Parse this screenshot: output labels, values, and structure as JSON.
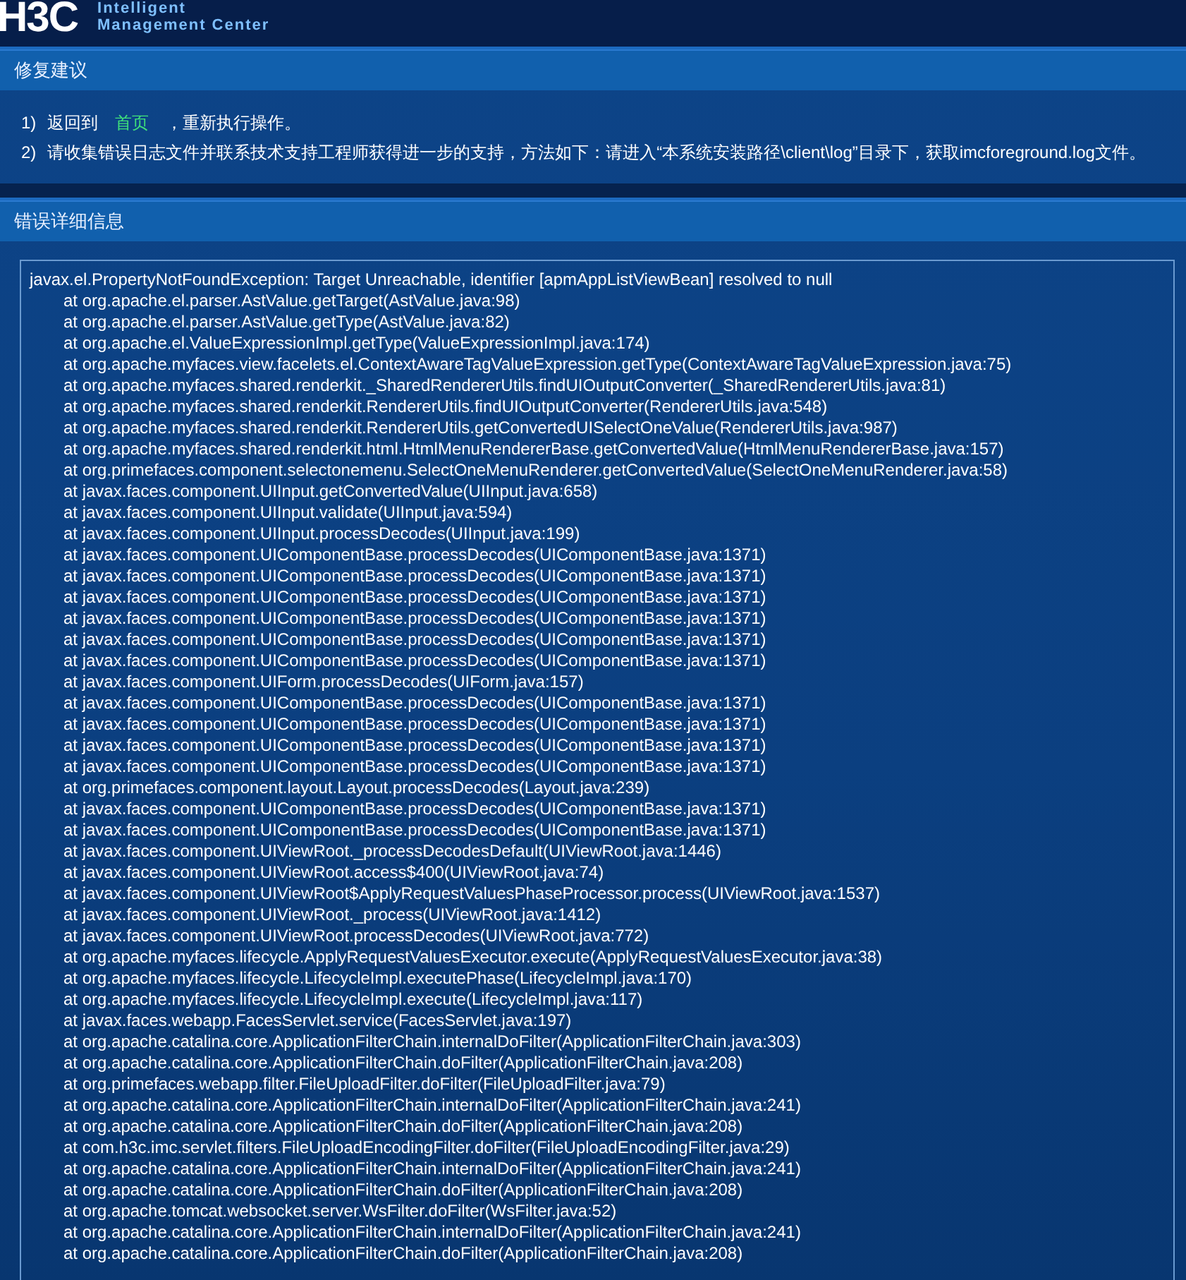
{
  "header": {
    "logo": "H3C",
    "product_line_1": "Intelligent",
    "product_line_2": "Management Center"
  },
  "repair": {
    "title": "修复建议",
    "steps": [
      {
        "number": "1)",
        "before": "返回到",
        "link": "首页",
        "after": "，重新执行操作。"
      },
      {
        "number": "2)",
        "before": "请收集错误日志文件并联系技术支持工程师获得进一步的支持，方法如下：请进入“本系统安装路径\\client\\log”目录下，获取imcforeground.log文件。"
      }
    ]
  },
  "details": {
    "title": "错误详细信息",
    "exception": "javax.el.PropertyNotFoundException: Target Unreachable, identifier [apmAppListViewBean] resolved to null",
    "frames": [
      "at org.apache.el.parser.AstValue.getTarget(AstValue.java:98)",
      "at org.apache.el.parser.AstValue.getType(AstValue.java:82)",
      "at org.apache.el.ValueExpressionImpl.getType(ValueExpressionImpl.java:174)",
      "at org.apache.myfaces.view.facelets.el.ContextAwareTagValueExpression.getType(ContextAwareTagValueExpression.java:75)",
      "at org.apache.myfaces.shared.renderkit._SharedRendererUtils.findUIOutputConverter(_SharedRendererUtils.java:81)",
      "at org.apache.myfaces.shared.renderkit.RendererUtils.findUIOutputConverter(RendererUtils.java:548)",
      "at org.apache.myfaces.shared.renderkit.RendererUtils.getConvertedUISelectOneValue(RendererUtils.java:987)",
      "at org.apache.myfaces.shared.renderkit.html.HtmlMenuRendererBase.getConvertedValue(HtmlMenuRendererBase.java:157)",
      "at org.primefaces.component.selectonemenu.SelectOneMenuRenderer.getConvertedValue(SelectOneMenuRenderer.java:58)",
      "at javax.faces.component.UIInput.getConvertedValue(UIInput.java:658)",
      "at javax.faces.component.UIInput.validate(UIInput.java:594)",
      "at javax.faces.component.UIInput.processDecodes(UIInput.java:199)",
      "at javax.faces.component.UIComponentBase.processDecodes(UIComponentBase.java:1371)",
      "at javax.faces.component.UIComponentBase.processDecodes(UIComponentBase.java:1371)",
      "at javax.faces.component.UIComponentBase.processDecodes(UIComponentBase.java:1371)",
      "at javax.faces.component.UIComponentBase.processDecodes(UIComponentBase.java:1371)",
      "at javax.faces.component.UIComponentBase.processDecodes(UIComponentBase.java:1371)",
      "at javax.faces.component.UIComponentBase.processDecodes(UIComponentBase.java:1371)",
      "at javax.faces.component.UIForm.processDecodes(UIForm.java:157)",
      "at javax.faces.component.UIComponentBase.processDecodes(UIComponentBase.java:1371)",
      "at javax.faces.component.UIComponentBase.processDecodes(UIComponentBase.java:1371)",
      "at javax.faces.component.UIComponentBase.processDecodes(UIComponentBase.java:1371)",
      "at javax.faces.component.UIComponentBase.processDecodes(UIComponentBase.java:1371)",
      "at org.primefaces.component.layout.Layout.processDecodes(Layout.java:239)",
      "at javax.faces.component.UIComponentBase.processDecodes(UIComponentBase.java:1371)",
      "at javax.faces.component.UIComponentBase.processDecodes(UIComponentBase.java:1371)",
      "at javax.faces.component.UIViewRoot._processDecodesDefault(UIViewRoot.java:1446)",
      "at javax.faces.component.UIViewRoot.access$400(UIViewRoot.java:74)",
      "at javax.faces.component.UIViewRoot$ApplyRequestValuesPhaseProcessor.process(UIViewRoot.java:1537)",
      "at javax.faces.component.UIViewRoot._process(UIViewRoot.java:1412)",
      "at javax.faces.component.UIViewRoot.processDecodes(UIViewRoot.java:772)",
      "at org.apache.myfaces.lifecycle.ApplyRequestValuesExecutor.execute(ApplyRequestValuesExecutor.java:38)",
      "at org.apache.myfaces.lifecycle.LifecycleImpl.executePhase(LifecycleImpl.java:170)",
      "at org.apache.myfaces.lifecycle.LifecycleImpl.execute(LifecycleImpl.java:117)",
      "at javax.faces.webapp.FacesServlet.service(FacesServlet.java:197)",
      "at org.apache.catalina.core.ApplicationFilterChain.internalDoFilter(ApplicationFilterChain.java:303)",
      "at org.apache.catalina.core.ApplicationFilterChain.doFilter(ApplicationFilterChain.java:208)",
      "at org.primefaces.webapp.filter.FileUploadFilter.doFilter(FileUploadFilter.java:79)",
      "at org.apache.catalina.core.ApplicationFilterChain.internalDoFilter(ApplicationFilterChain.java:241)",
      "at org.apache.catalina.core.ApplicationFilterChain.doFilter(ApplicationFilterChain.java:208)",
      "at com.h3c.imc.servlet.filters.FileUploadEncodingFilter.doFilter(FileUploadEncodingFilter.java:29)",
      "at org.apache.catalina.core.ApplicationFilterChain.internalDoFilter(ApplicationFilterChain.java:241)",
      "at org.apache.catalina.core.ApplicationFilterChain.doFilter(ApplicationFilterChain.java:208)",
      "at org.apache.tomcat.websocket.server.WsFilter.doFilter(WsFilter.java:52)",
      "at org.apache.catalina.core.ApplicationFilterChain.internalDoFilter(ApplicationFilterChain.java:241)",
      "at org.apache.catalina.core.ApplicationFilterChain.doFilter(ApplicationFilterChain.java:208)"
    ]
  }
}
